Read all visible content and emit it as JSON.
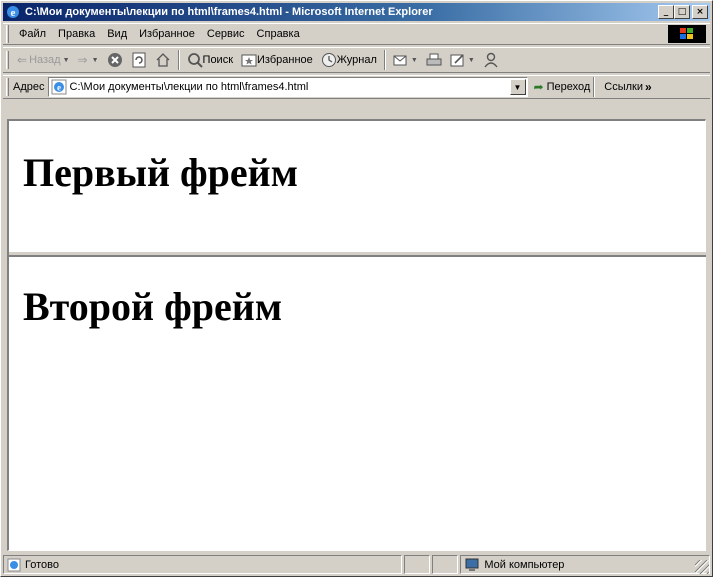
{
  "window": {
    "title": "C:\\Мои документы\\лекции по html\\frames4.html - Microsoft Internet Explorer",
    "buttons": {
      "minimize": "_",
      "maximize": "□",
      "close": "×"
    }
  },
  "menu": {
    "items": [
      {
        "label": "Файл"
      },
      {
        "label": "Правка"
      },
      {
        "label": "Вид"
      },
      {
        "label": "Избранное"
      },
      {
        "label": "Сервис"
      },
      {
        "label": "Справка"
      }
    ]
  },
  "toolbar": {
    "back": {
      "label": "Назад",
      "icon": "back-arrow-icon"
    },
    "forward": {
      "icon": "forward-arrow-icon"
    },
    "stop": {
      "icon": "stop-icon"
    },
    "refresh": {
      "icon": "refresh-icon"
    },
    "home": {
      "icon": "home-icon"
    },
    "search": {
      "label": "Поиск",
      "icon": "search-icon"
    },
    "favorites": {
      "label": "Избранное",
      "icon": "favorites-icon"
    },
    "history": {
      "label": "Журнал",
      "icon": "history-icon"
    },
    "mail": {
      "icon": "mail-icon"
    },
    "print": {
      "icon": "print-icon"
    },
    "edit": {
      "icon": "edit-icon"
    },
    "messenger": {
      "icon": "messenger-icon"
    }
  },
  "address": {
    "label": "Адрес",
    "value": "C:\\Мои документы\\лекции по html\\frames4.html",
    "go_label": "Переход",
    "links_label": "Ссылки",
    "links_chevron": "»"
  },
  "frames": {
    "first": {
      "heading": "Первый фрейм"
    },
    "second": {
      "heading": "Второй фрейм"
    }
  },
  "status": {
    "text": "Готово",
    "zone": "Мой компьютер"
  },
  "colors": {
    "title_active_start": "#0a246a",
    "title_active_end": "#a6caf0",
    "chrome": "#d4d0c8"
  }
}
